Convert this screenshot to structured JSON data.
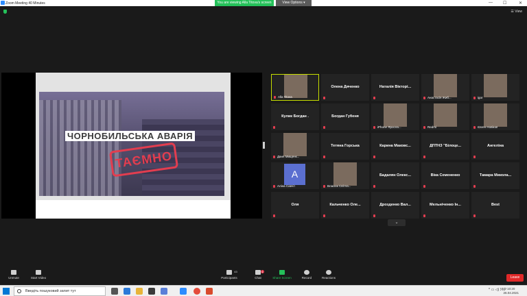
{
  "window": {
    "title": "Zoom Meeting 40 Minutes",
    "share_banner": "You are viewing Alla Titova's screen",
    "view_options": "View Options ▾",
    "view_button": "☰ View"
  },
  "slide": {
    "title": "ЧОРНОБИЛЬСЬКА АВАРІЯ",
    "stamp": "ТАЄМНО"
  },
  "gallery": {
    "tiles": [
      {
        "name": "Alla Titova",
        "label_style": "small",
        "has_photo": true
      },
      {
        "name": "Олена Дяченко",
        "label_style": "center"
      },
      {
        "name": "Наталія Вікторі...",
        "label_style": "center"
      },
      {
        "name": "Анастасія Жиб...",
        "label_style": "small",
        "has_photo": true
      },
      {
        "name": "igor",
        "label_style": "small",
        "has_photo": true
      },
      {
        "name": "Кулик Богдан .",
        "label_style": "center"
      },
      {
        "name": "Богдан Губеня",
        "label_style": "center"
      },
      {
        "name": "iPhone Яросла...",
        "label_style": "small",
        "has_photo": true
      },
      {
        "name": "Redmi",
        "label_style": "small",
        "has_photo": true
      },
      {
        "name": "Євген Новіков",
        "label_style": "small",
        "has_photo": true
      },
      {
        "name": "Даня Мищенк...",
        "label_style": "small",
        "has_photo": true
      },
      {
        "name": "Тетяна Горська",
        "label_style": "center"
      },
      {
        "name": "Карина Маковс...",
        "label_style": "center"
      },
      {
        "name": "ДПТНЗ \"Білоце...",
        "label_style": "center"
      },
      {
        "name": "Ангеліна",
        "label_style": "center"
      },
      {
        "name": "Аліна Савчіт",
        "label_style": "small",
        "avatar_letter": "A"
      },
      {
        "name": "Власюк Світла...",
        "label_style": "small",
        "has_photo": true
      },
      {
        "name": "Бадалян Олекс...",
        "label_style": "center"
      },
      {
        "name": "Віка Семененко",
        "label_style": "center"
      },
      {
        "name": "Тамара Микола...",
        "label_style": "center"
      },
      {
        "name": "Оля",
        "label_style": "center"
      },
      {
        "name": "Кальченко Оле...",
        "label_style": "center"
      },
      {
        "name": "Дрозденко Вал...",
        "label_style": "center"
      },
      {
        "name": "Мельніченко Ін...",
        "label_style": "center"
      },
      {
        "name": "Best",
        "label_style": "center"
      }
    ],
    "more_label": "⌄"
  },
  "toolbar": {
    "unmute": "Unmute",
    "start_video": "Start Video",
    "participants": "Participants",
    "participants_count": "43",
    "chat": "Chat",
    "chat_badge": "1",
    "share_screen": "Share Screen",
    "record": "Record",
    "reactions": "Reactions",
    "leave": "Leave"
  },
  "taskbar": {
    "search_placeholder": "Введіть пошуковий запит тут",
    "time": "10:20",
    "date": "26.04.2021"
  },
  "colors": {
    "accent_green": "#25c15a",
    "leave_red": "#e02828",
    "zoom_blue": "#2d8cff"
  }
}
